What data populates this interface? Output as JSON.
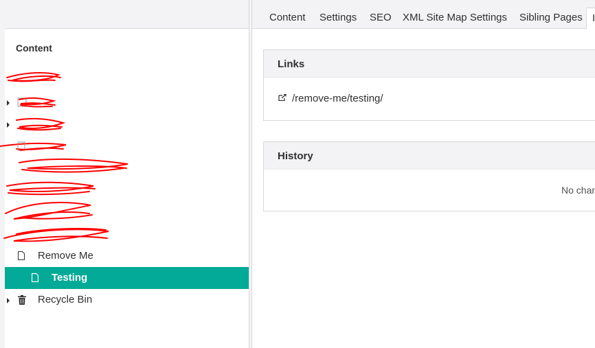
{
  "tree": {
    "title": "Content",
    "items": [
      {
        "label": "Remove Me",
        "icon": "document-icon",
        "has_children": false
      },
      {
        "label": "Testing",
        "icon": "document-icon",
        "has_children": false,
        "selected": true
      },
      {
        "label": "Recycle Bin",
        "icon": "trash-icon",
        "has_children": true
      }
    ]
  },
  "tabs": [
    {
      "label": "Content"
    },
    {
      "label": "Settings"
    },
    {
      "label": "SEO"
    },
    {
      "label": "XML Site Map Settings"
    },
    {
      "label": "Sibling Pages"
    },
    {
      "label": "I"
    }
  ],
  "links_panel": {
    "title": "Links",
    "url": "/remove-me/testing/",
    "icon": "external-link-icon"
  },
  "history_panel": {
    "title": "History",
    "empty_text": "No chan"
  },
  "colors": {
    "selected": "#03aa97",
    "panel_bg": "#f3f3f5",
    "redaction": "#ff0000"
  }
}
